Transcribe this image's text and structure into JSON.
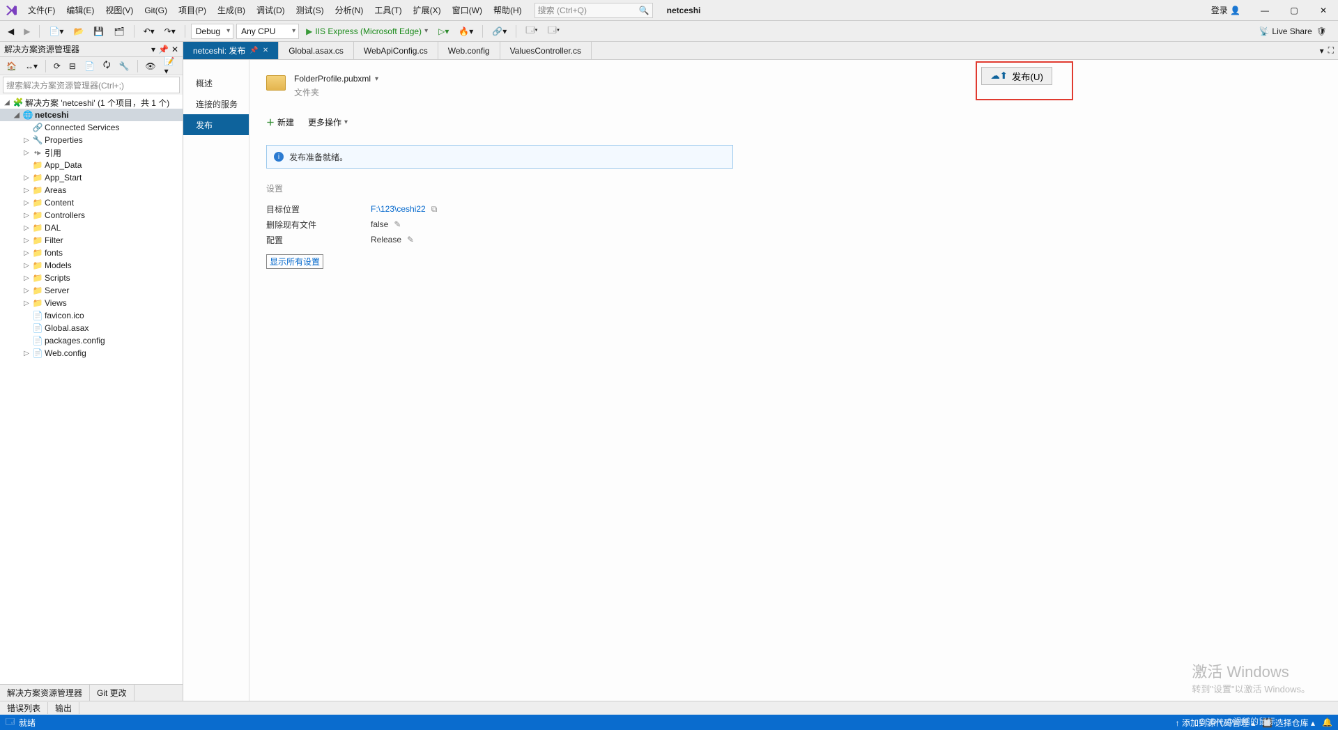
{
  "menu": {
    "file": "文件(F)",
    "edit": "编辑(E)",
    "view": "视图(V)",
    "git": "Git(G)",
    "project": "项目(P)",
    "build": "生成(B)",
    "debug": "调试(D)",
    "test": "测试(S)",
    "analyze": "分析(N)",
    "tools": "工具(T)",
    "extensions": "扩展(X)",
    "window": "窗口(W)",
    "help": "帮助(H)"
  },
  "title": {
    "search_placeholder": "搜索 (Ctrl+Q)",
    "project_name": "netceshi",
    "login": "登录"
  },
  "toolbar": {
    "config": "Debug",
    "platform": "Any CPU",
    "run_label": "IIS Express (Microsoft Edge)",
    "live_share": "Live Share"
  },
  "solution": {
    "panel_title": "解决方案资源管理器",
    "search_placeholder": "搜索解决方案资源管理器(Ctrl+;)",
    "root": "解决方案 'netceshi' (1 个项目，共 1 个)",
    "project": "netceshi",
    "nodes": [
      {
        "label": "Connected Services",
        "icon": "link"
      },
      {
        "label": "Properties",
        "icon": "wrench",
        "expand": true
      },
      {
        "label": "引用",
        "icon": "ref",
        "expand": true
      },
      {
        "label": "App_Data",
        "icon": "folder"
      },
      {
        "label": "App_Start",
        "icon": "folder",
        "expand": true
      },
      {
        "label": "Areas",
        "icon": "folder",
        "expand": true
      },
      {
        "label": "Content",
        "icon": "folder",
        "expand": true
      },
      {
        "label": "Controllers",
        "icon": "folder",
        "expand": true
      },
      {
        "label": "DAL",
        "icon": "folder",
        "expand": true
      },
      {
        "label": "Filter",
        "icon": "folder",
        "expand": true
      },
      {
        "label": "fonts",
        "icon": "folder",
        "expand": true
      },
      {
        "label": "Models",
        "icon": "folder",
        "expand": true
      },
      {
        "label": "Scripts",
        "icon": "folder",
        "expand": true
      },
      {
        "label": "Server",
        "icon": "folder",
        "expand": true
      },
      {
        "label": "Views",
        "icon": "folder",
        "expand": true
      },
      {
        "label": "favicon.ico",
        "icon": "file"
      },
      {
        "label": "Global.asax",
        "icon": "file"
      },
      {
        "label": "packages.config",
        "icon": "file"
      },
      {
        "label": "Web.config",
        "icon": "file",
        "expand": true
      }
    ],
    "bottom_tabs": [
      "解决方案资源管理器",
      "Git 更改"
    ]
  },
  "tabs": [
    {
      "label": "netceshi: 发布",
      "active": true,
      "pinned": true
    },
    {
      "label": "Global.asax.cs"
    },
    {
      "label": "WebApiConfig.cs"
    },
    {
      "label": "Web.config"
    },
    {
      "label": "ValuesController.cs"
    }
  ],
  "publish": {
    "side": [
      "概述",
      "连接的服务",
      "发布"
    ],
    "side_active_index": 2,
    "profile_name": "FolderProfile.pubxml",
    "profile_sub": "文件夹",
    "publish_btn": "发布(U)",
    "new_btn": "新建",
    "more_btn": "更多操作",
    "info_msg": "发布准备就绪。",
    "settings_title": "设置",
    "rows": [
      {
        "k": "目标位置",
        "v": "F:\\123\\ceshi22",
        "link": true,
        "icon": "copy"
      },
      {
        "k": "删除现有文件",
        "v": "false",
        "icon": "edit"
      },
      {
        "k": "配置",
        "v": "Release",
        "icon": "edit"
      }
    ],
    "show_all": "显示所有设置"
  },
  "bottom_tabs": [
    "错误列表",
    "输出"
  ],
  "statusbar": {
    "ready": "就绪",
    "scm": "添加到源代码管理",
    "repo": "选择仓库"
  },
  "watermark": {
    "l1": "激活 Windows",
    "l2": "转到\"设置\"以激活 Windows。"
  },
  "csdn": "CSDN @滑稽的鼠标"
}
